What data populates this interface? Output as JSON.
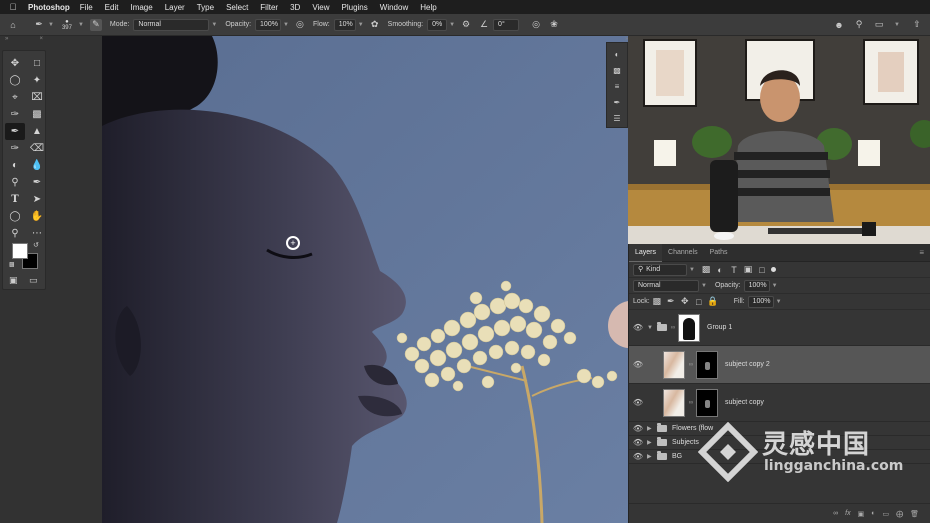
{
  "menubar": {
    "app_name": "Photoshop",
    "items": [
      "File",
      "Edit",
      "Image",
      "Layer",
      "Type",
      "Select",
      "Filter",
      "3D",
      "View",
      "Plugins",
      "Window",
      "Help"
    ]
  },
  "options_bar": {
    "brush_size": "397",
    "mode_label": "Mode:",
    "mode_value": "Normal",
    "opacity_label": "Opacity:",
    "opacity_value": "100%",
    "flow_label": "Flow:",
    "flow_value": "10%",
    "smoothing_label": "Smoothing:",
    "smoothing_value": "0%",
    "angle_value": "0°"
  },
  "colors": {
    "foreground": "#ffffff",
    "background": "#000000",
    "canvas_bg": "#5e7396"
  },
  "layers_panel": {
    "tabs": [
      "Layers",
      "Channels",
      "Paths"
    ],
    "filter_value": "Kind",
    "blend_mode": "Normal",
    "opacity_label": "Opacity:",
    "opacity_value": "100%",
    "lock_label": "Lock:",
    "fill_label": "Fill:",
    "fill_value": "100%",
    "layers": [
      {
        "name": "Group 1"
      },
      {
        "name": "subject copy 2"
      },
      {
        "name": "subject copy"
      },
      {
        "name": "Flowers (flow"
      },
      {
        "name": "Subjects"
      },
      {
        "name": "BG"
      }
    ]
  },
  "watermark": {
    "chinese": "灵感中国",
    "english": "lingganchina.com"
  }
}
